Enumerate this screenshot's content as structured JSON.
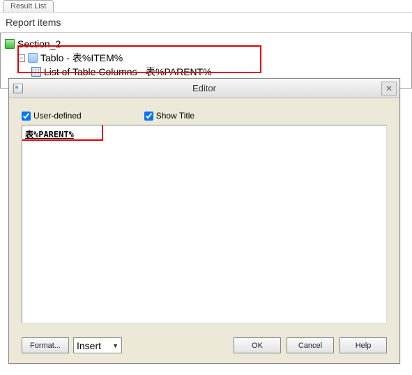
{
  "tab": {
    "label": "Result List"
  },
  "panel": {
    "title": "Report items"
  },
  "tree": {
    "section": {
      "label": "Section_2"
    },
    "tablo": {
      "label": "Tablo - 表%ITEM%"
    },
    "listcols": {
      "label": "List of Table Columns - 表%PARENT%"
    }
  },
  "editor": {
    "title": "Editor",
    "userDefined": "User-defined",
    "showTitle": "Show Title",
    "content": "表%PARENT%",
    "buttons": {
      "format": "Format...",
      "insert": "Insert",
      "ok": "OK",
      "cancel": "Cancel",
      "help": "Help"
    }
  }
}
